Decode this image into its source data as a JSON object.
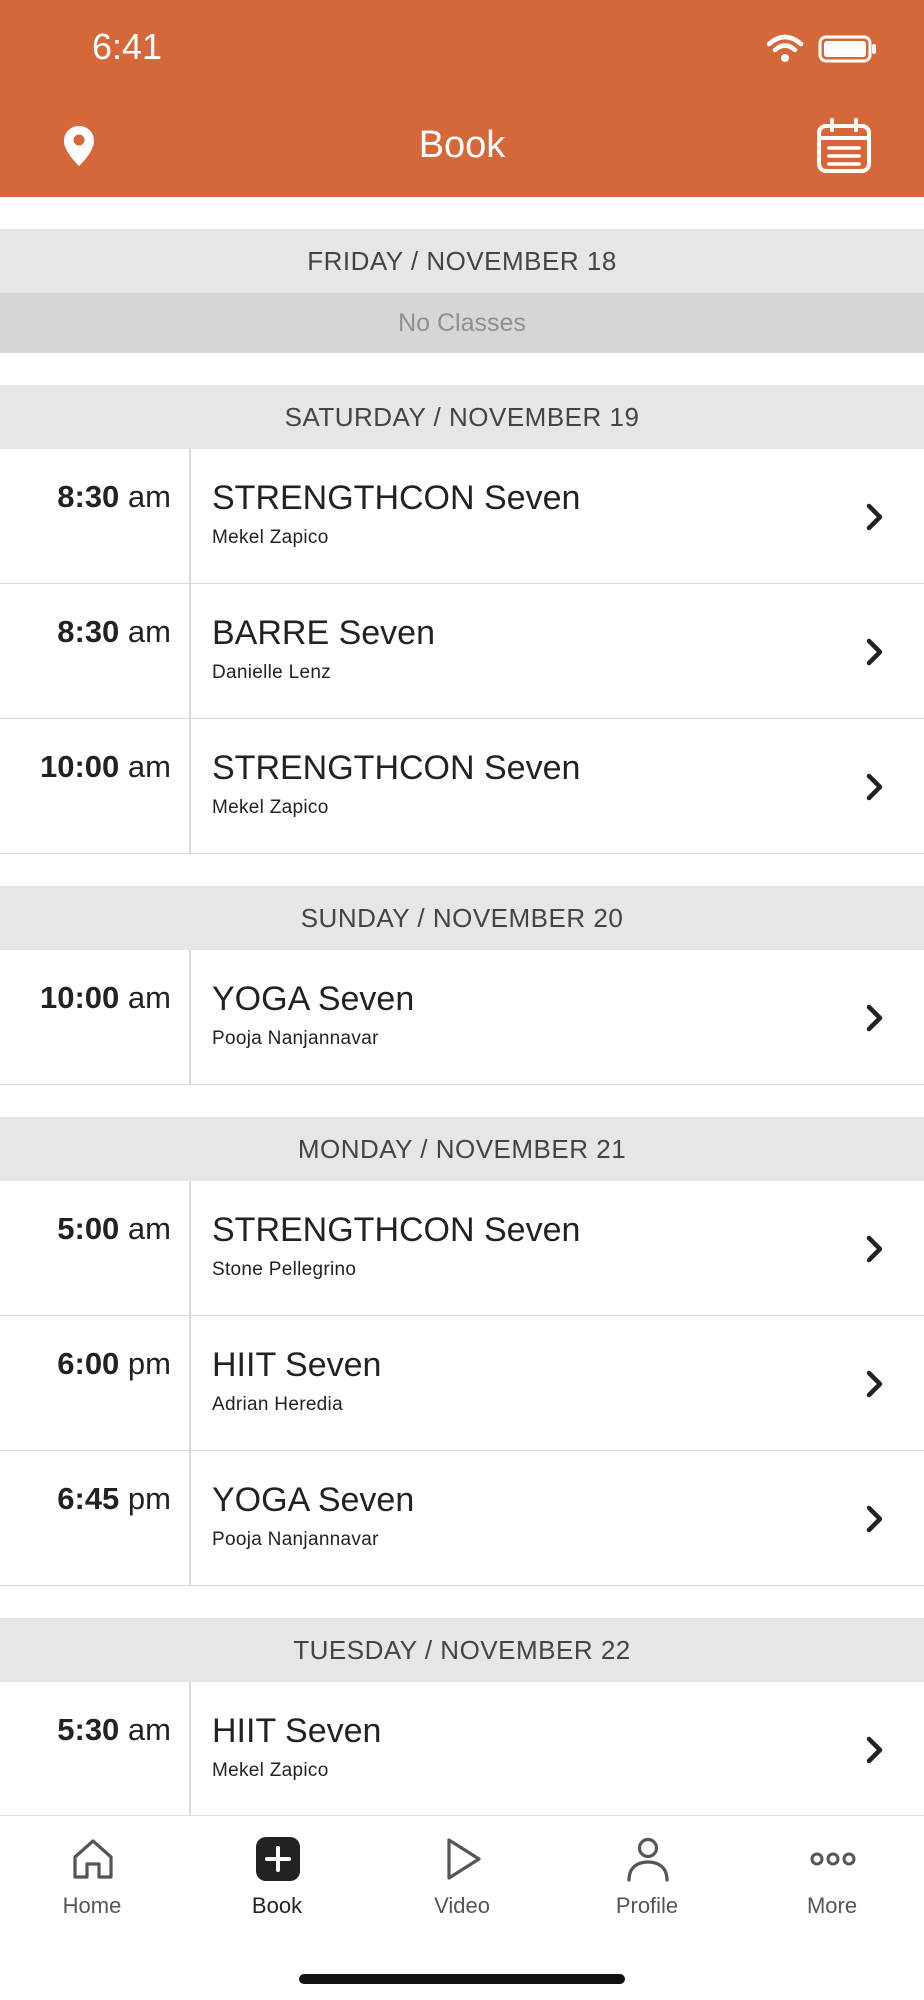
{
  "status_bar": {
    "time": "6:41"
  },
  "header": {
    "title": "Book"
  },
  "colors": {
    "brand": "#D5683A",
    "day_header_bg": "#E6E6E6",
    "no_classes_bg": "#D6D6D6"
  },
  "days": [
    {
      "heading": "FRIDAY / NOVEMBER 18",
      "no_classes": "No Classes",
      "classes": []
    },
    {
      "heading": "SATURDAY / NOVEMBER 19",
      "classes": [
        {
          "time_num": "8:30",
          "time_ampm": "am",
          "name": "STRENGTHCON Seven",
          "instructor": "Mekel Zapico"
        },
        {
          "time_num": "8:30",
          "time_ampm": "am",
          "name": "BARRE Seven",
          "instructor": "Danielle Lenz"
        },
        {
          "time_num": "10:00",
          "time_ampm": "am",
          "name": "STRENGTHCON Seven",
          "instructor": "Mekel Zapico"
        }
      ]
    },
    {
      "heading": "SUNDAY / NOVEMBER 20",
      "classes": [
        {
          "time_num": "10:00",
          "time_ampm": "am",
          "name": "YOGA Seven",
          "instructor": "Pooja Nanjannavar"
        }
      ]
    },
    {
      "heading": "MONDAY / NOVEMBER 21",
      "classes": [
        {
          "time_num": "5:00",
          "time_ampm": "am",
          "name": "STRENGTHCON Seven",
          "instructor": "Stone Pellegrino"
        },
        {
          "time_num": "6:00",
          "time_ampm": "pm",
          "name": "HIIT Seven",
          "instructor": "Adrian Heredia"
        },
        {
          "time_num": "6:45",
          "time_ampm": "pm",
          "name": "YOGA Seven",
          "instructor": "Pooja Nanjannavar"
        }
      ]
    },
    {
      "heading": "TUESDAY / NOVEMBER 22",
      "classes": [
        {
          "time_num": "5:30",
          "time_ampm": "am",
          "name": "HIIT Seven",
          "instructor": "Mekel Zapico"
        }
      ]
    }
  ],
  "tabs": [
    {
      "label": "Home",
      "icon": "home-icon"
    },
    {
      "label": "Book",
      "icon": "book-plus-icon",
      "active": true
    },
    {
      "label": "Video",
      "icon": "play-icon"
    },
    {
      "label": "Profile",
      "icon": "profile-icon"
    },
    {
      "label": "More",
      "icon": "more-icon"
    }
  ]
}
